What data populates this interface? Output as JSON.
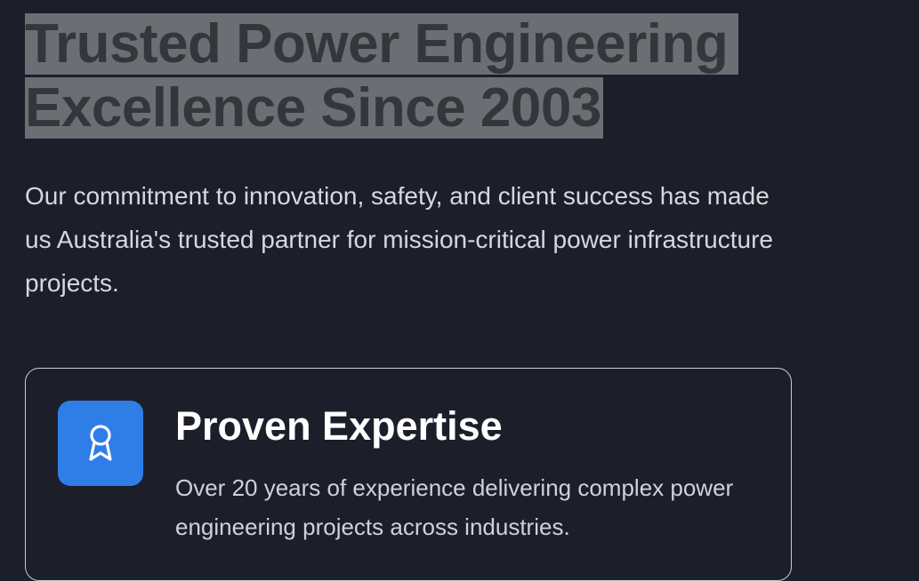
{
  "hero": {
    "headline_line1": "Trusted Power Engineering",
    "headline_line2": "Excellence Since 2003",
    "lead": "Our commitment to innovation, safety, and client success has made us Australia's trusted partner for mission-critical power infrastructure projects."
  },
  "feature_card": {
    "icon": "award-icon",
    "title": "Proven Expertise",
    "description": "Over 20 years of experience delivering complex power engineering projects across industries."
  },
  "colors": {
    "background": "#1c1f2a",
    "selection_highlight": "#6b6e73",
    "icon_accent": "#2f7ee8",
    "card_border": "#c9ccd3"
  }
}
